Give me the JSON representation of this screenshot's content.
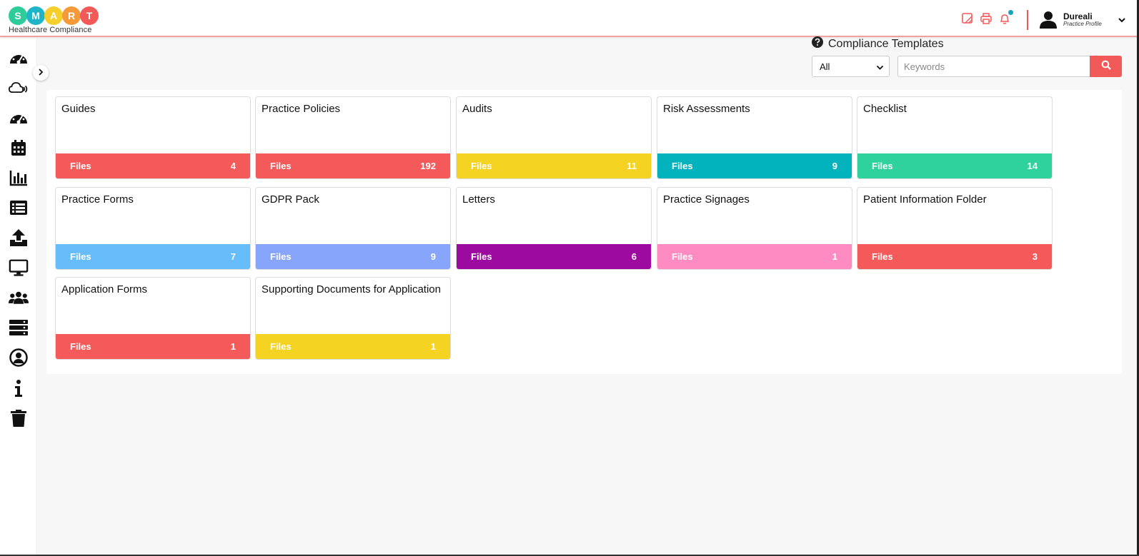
{
  "brand": {
    "letters": [
      {
        "char": "S",
        "color": "#2ecc9a"
      },
      {
        "char": "M",
        "color": "#1fb5c9"
      },
      {
        "char": "A",
        "color": "#f5cf2b"
      },
      {
        "char": "R",
        "color": "#f59a3b"
      },
      {
        "char": "T",
        "color": "#f25a5a"
      }
    ],
    "subtitle": "Healthcare Compliance"
  },
  "header": {
    "user_name": "Dureali",
    "user_role": "Practice Profile",
    "accent": "#f25a5a",
    "icons": [
      "note-icon",
      "printer-icon",
      "bell-icon"
    ]
  },
  "sidebar": {
    "icons": [
      "dashboard-icon",
      "cloud-broadcast-icon",
      "dashboard-icon",
      "calendar-icon",
      "bar-chart-icon",
      "list-icon",
      "upload-icon",
      "monitor-icon",
      "users-icon",
      "server-icon",
      "user-circle-icon",
      "info-icon",
      "trash-icon"
    ]
  },
  "templates": {
    "title": "Compliance Templates",
    "filter_value": "All",
    "search_placeholder": "Keywords"
  },
  "cards": [
    {
      "title": "Guides",
      "label": "Files",
      "count": "4",
      "color": "#f55a5a"
    },
    {
      "title": "Practice Policies",
      "label": "Files",
      "count": "192",
      "color": "#f55a5a"
    },
    {
      "title": "Audits",
      "label": "Files",
      "count": "11",
      "color": "#f5d323"
    },
    {
      "title": "Risk Assessments",
      "label": "Files",
      "count": "9",
      "color": "#02b3bd"
    },
    {
      "title": "Checklist",
      "label": "Files",
      "count": "14",
      "color": "#2fd19d"
    },
    {
      "title": "Practice Forms",
      "label": "Files",
      "count": "7",
      "color": "#66bdfa"
    },
    {
      "title": "GDPR Pack",
      "label": "Files",
      "count": "9",
      "color": "#87a5fb"
    },
    {
      "title": "Letters",
      "label": "Files",
      "count": "6",
      "color": "#9c0aa0"
    },
    {
      "title": "Practice Signages",
      "label": "Files",
      "count": "1",
      "color": "#fe8cc2"
    },
    {
      "title": "Patient Information Folder",
      "label": "Files",
      "count": "3",
      "color": "#f55a5a"
    },
    {
      "title": "Application Forms",
      "label": "Files",
      "count": "1",
      "color": "#f55a5a"
    },
    {
      "title": "Supporting Documents for Application",
      "label": "Files",
      "count": "1",
      "color": "#f5d323"
    }
  ]
}
